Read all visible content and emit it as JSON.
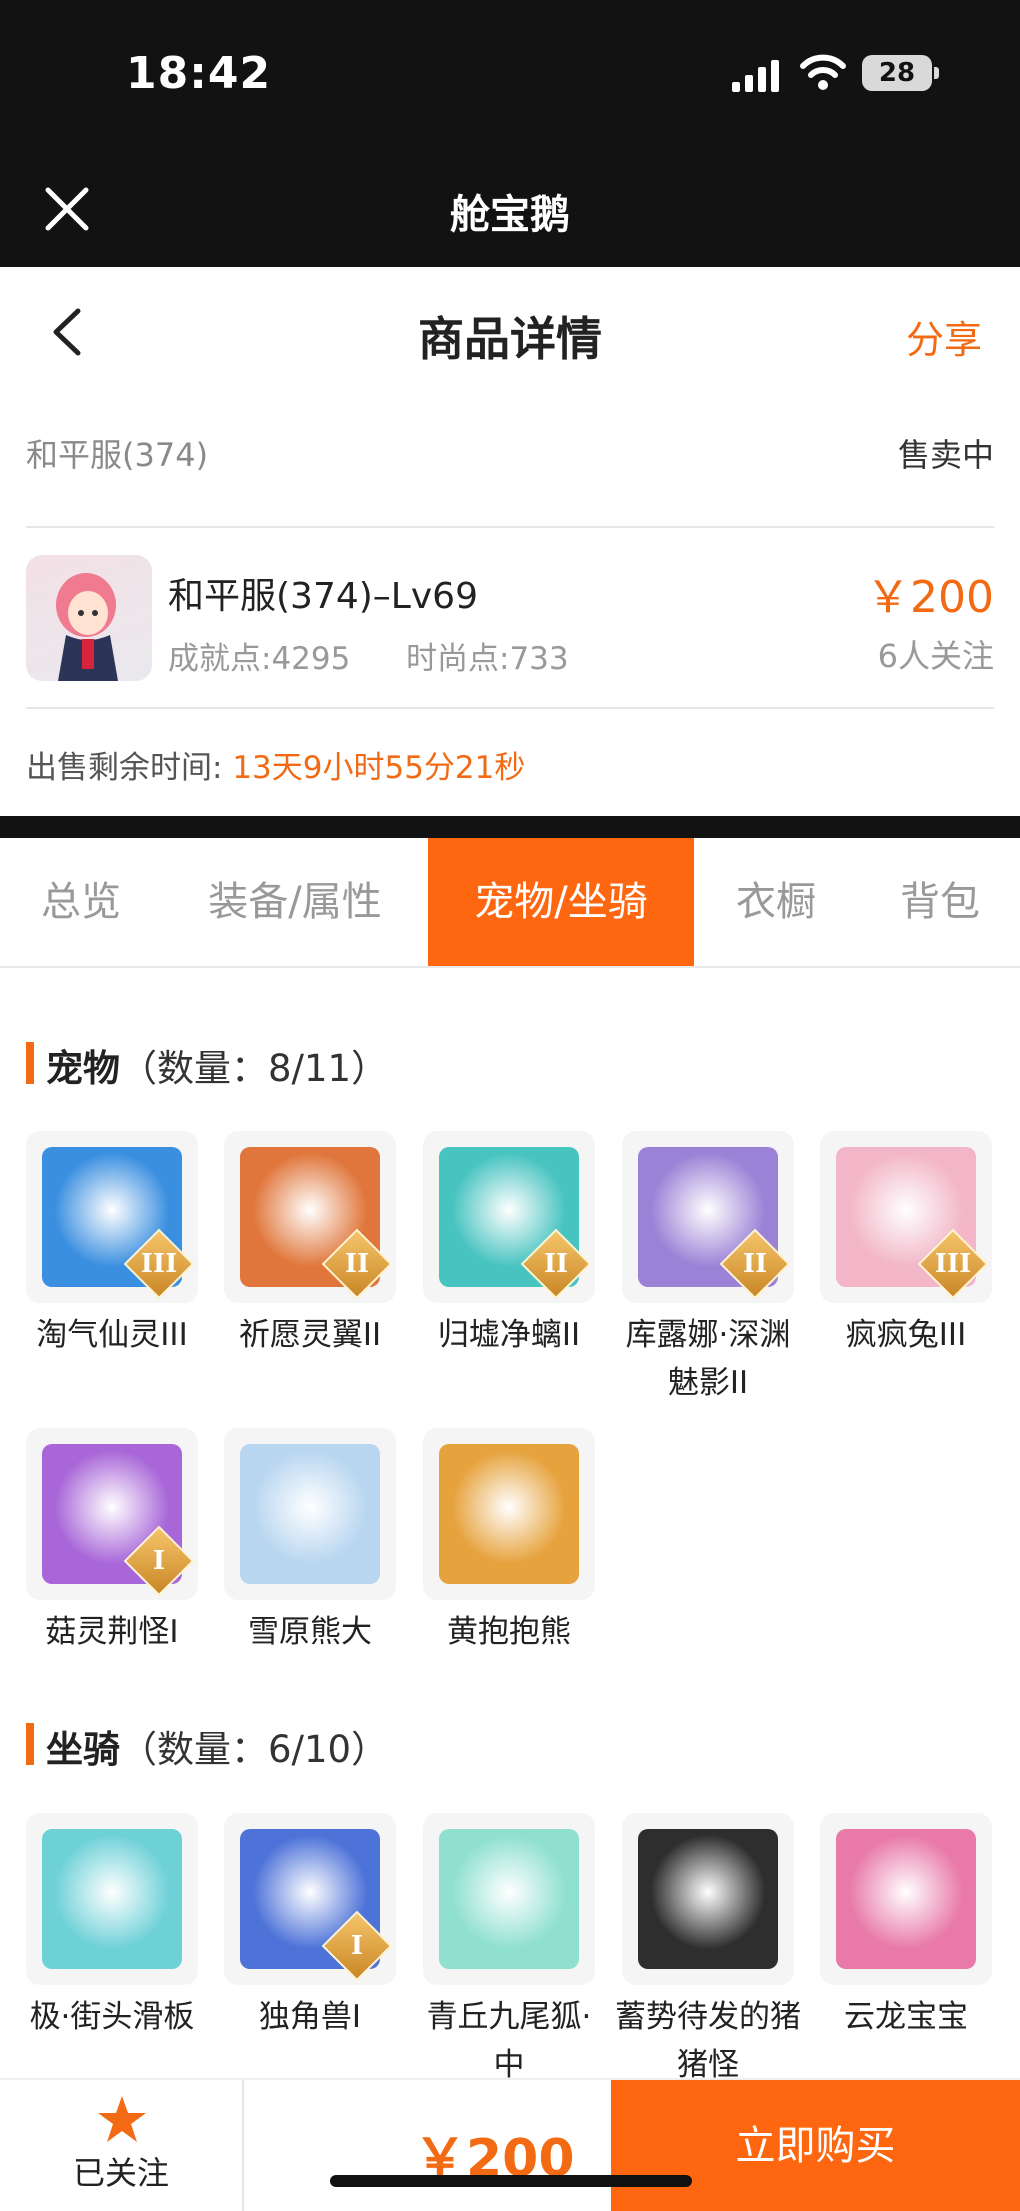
{
  "status_bar": {
    "time": "18:42",
    "battery": "28"
  },
  "app_bar": {
    "title": "舱宝鹅"
  },
  "header": {
    "title": "商品详情",
    "share_label": "分享"
  },
  "listing": {
    "server": "和平服(374)",
    "status": "售卖中",
    "name": "和平服(374)–Lv69",
    "achievement": "成就点:4295",
    "fashion": "时尚点:733",
    "price": "￥200",
    "followers": "6人关注",
    "remaining_label": "出售剩余时间:",
    "remaining_value": "13天9小时55分21秒"
  },
  "tabs": [
    {
      "label": "总览",
      "active": false
    },
    {
      "label": "装备/属性",
      "active": false
    },
    {
      "label": "宠物/坐骑",
      "active": true
    },
    {
      "label": "衣橱",
      "active": false
    },
    {
      "label": "背包",
      "active": false
    }
  ],
  "pets": {
    "title": "宠物",
    "count": "（数量：8/11）",
    "items": [
      {
        "name": "淘气仙灵III",
        "tier": "III",
        "color": "#3b8fe0"
      },
      {
        "name": "祈愿灵翼II",
        "tier": "II",
        "color": "#e0763b"
      },
      {
        "name": "归墟净螭II",
        "tier": "II",
        "color": "#47c3c0"
      },
      {
        "name": "库露娜·深渊魅影II",
        "tier": "II",
        "color": "#9b82d6"
      },
      {
        "name": "疯疯兔III",
        "tier": "III",
        "color": "#f2b6c8"
      },
      {
        "name": "菇灵荆怪I",
        "tier": "I",
        "color": "#a866d8"
      },
      {
        "name": "雪原熊大",
        "tier": "",
        "color": "#b8d6f0"
      },
      {
        "name": "黄抱抱熊",
        "tier": "",
        "color": "#e6a23c"
      }
    ]
  },
  "mounts": {
    "title": "坐骑",
    "count": "（数量：6/10）",
    "items": [
      {
        "name": "极·街头滑板",
        "tier": "",
        "color": "#6fd1d8"
      },
      {
        "name": "独角兽I",
        "tier": "I",
        "color": "#4d72d8"
      },
      {
        "name": "青丘九尾狐·中",
        "tier": "",
        "color": "#8fe0d0"
      },
      {
        "name": "蓄势待发的猪猪怪",
        "tier": "",
        "color": "#2e2e2e"
      },
      {
        "name": "云龙宝宝",
        "tier": "",
        "color": "#e879a8"
      }
    ]
  },
  "bottom_bar": {
    "follow_label": "已关注",
    "price": "￥200",
    "buy_label": "立即购买"
  }
}
